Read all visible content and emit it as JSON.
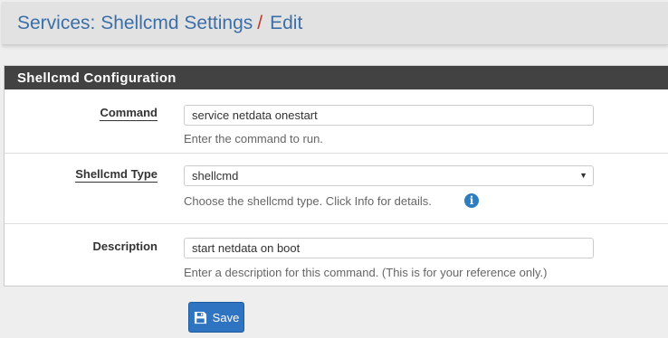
{
  "breadcrumb": {
    "section": "Services: Shellcmd Settings",
    "separator": "/",
    "page": "Edit"
  },
  "panel": {
    "title": "Shellcmd Configuration"
  },
  "form": {
    "command": {
      "label": "Command",
      "value": "service netdata onestart",
      "help": "Enter the command to run."
    },
    "type": {
      "label": "Shellcmd Type",
      "value": "shellcmd",
      "help": "Choose the shellcmd type. Click Info for details.",
      "info_icon": "info-circle-icon"
    },
    "description": {
      "label": "Description",
      "value": "start netdata on boot",
      "help": "Enter a description for this command. (This is for your reference only.)"
    }
  },
  "actions": {
    "save_label": "Save",
    "save_icon": "floppy-disk-icon"
  },
  "colors": {
    "link": "#3b6fa8",
    "separator": "#c0392b",
    "panel_heading": "#424242",
    "primary_button": "#2f74c0",
    "info_icon": "#2e7dc1"
  }
}
